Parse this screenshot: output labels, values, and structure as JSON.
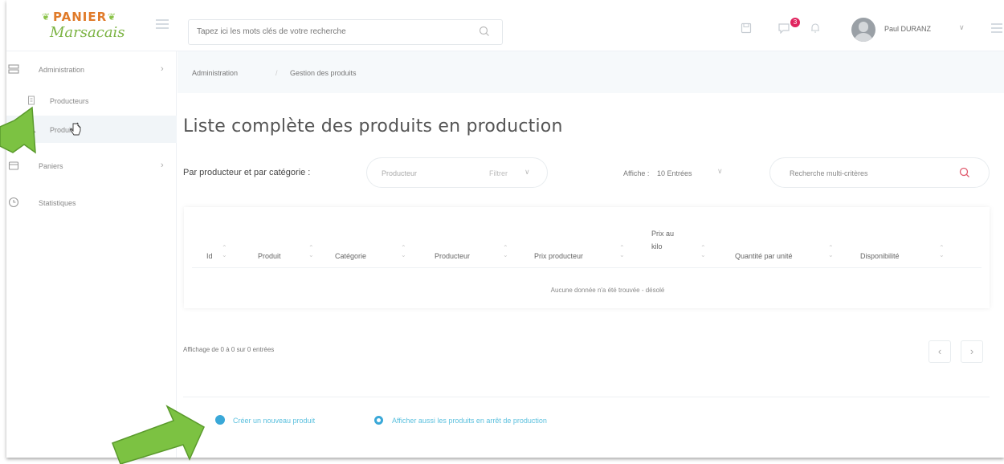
{
  "brand": {
    "logo_line1": "PANIER",
    "logo_line2": "Marsacais"
  },
  "topbar": {
    "search_placeholder": "Tapez ici les mots clés de votre recherche",
    "notification_count": "3",
    "user_name": "Paul DURANZ"
  },
  "sidebar": {
    "items": [
      {
        "label": "Administration"
      },
      {
        "label": "Paniers"
      },
      {
        "label": "Statistiques"
      }
    ],
    "sub_items": [
      {
        "label": "Producteurs"
      },
      {
        "label": "Produits"
      }
    ]
  },
  "breadcrumb": {
    "level1": "Administration",
    "level2": "Gestion des produits"
  },
  "page": {
    "title": "Liste complète des produits en production"
  },
  "filters": {
    "label": "Par producteur et par catégorie :",
    "producer_placeholder": "Producteur",
    "filter_label": "Filtrer",
    "show_label": "Affiche :",
    "show_value": "10 Entrées",
    "multi_search_placeholder": "Recherche multi-critères"
  },
  "table": {
    "columns": [
      "Id",
      "Produit",
      "Catégorie",
      "Producteur",
      "Prix producteur",
      "Prix au kilo",
      "Quantité par unité",
      "Disponibilité"
    ],
    "empty_message": "Aucune donnée n'a été trouvée - désolé"
  },
  "pagination": {
    "info": "Affichage de 0 à 0 sur 0 entrées",
    "prev": "‹",
    "next": "›"
  },
  "actions": {
    "create": "Créer un nouveau produit",
    "show_stopped": "Afficher aussi les produits en arrêt de production"
  },
  "colors": {
    "accent": "#3aa8d8",
    "arrow": "#7cc242",
    "badge": "#e0245e"
  }
}
